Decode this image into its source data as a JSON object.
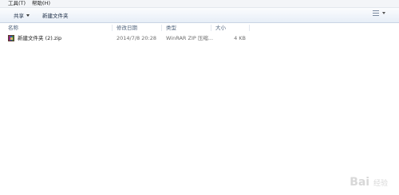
{
  "menu": {
    "tools": "工具(T)",
    "help": "帮助(H)"
  },
  "toolbar": {
    "share": "共享",
    "new_folder": "新建文件夹"
  },
  "columns": {
    "name": "名称",
    "modified": "修改日期",
    "type": "类型",
    "size": "大小"
  },
  "files": [
    {
      "name": "新建文件夹 (2).zip",
      "modified": "2014/7/8 20:28",
      "type": "WinRAR ZIP 压缩...",
      "size": "4 KB",
      "icon": "winrar-zip-icon"
    }
  ],
  "watermark": {
    "text": "Bai",
    "suffix": "经验"
  },
  "colors": {
    "toolbar_bg": "#e7eef7",
    "header_text": "#4c607a"
  }
}
